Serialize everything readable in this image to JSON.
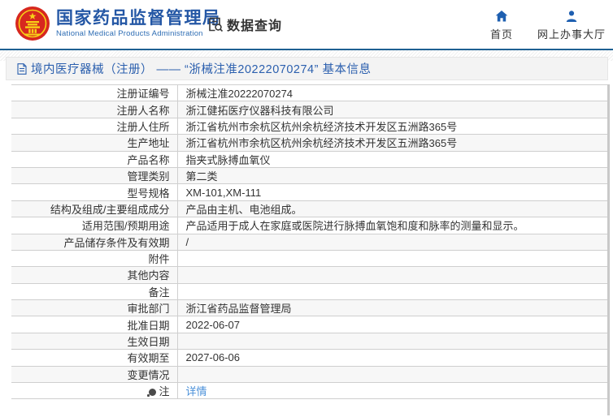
{
  "header": {
    "org_name_zh": "国家药品监督管理局",
    "org_name_en": "National Medical Products Administration",
    "data_query_label": "数据查询",
    "nav": [
      {
        "label": "首页",
        "icon": "home-icon"
      },
      {
        "label": "网上办事大厅",
        "icon": "user-icon"
      }
    ]
  },
  "breadcrumb": {
    "text": "境内医疗器械（注册） —— “浙械注准20222070274” 基本信息"
  },
  "table": {
    "rows": [
      {
        "label": "注册证编号",
        "value": "浙械注准20222070274"
      },
      {
        "label": "注册人名称",
        "value": "浙江健拓医疗仪器科技有限公司"
      },
      {
        "label": "注册人住所",
        "value": "浙江省杭州市余杭区杭州余杭经济技术开发区五洲路365号"
      },
      {
        "label": "生产地址",
        "value": "浙江省杭州市余杭区杭州余杭经济技术开发区五洲路365号"
      },
      {
        "label": "产品名称",
        "value": "指夹式脉搏血氧仪"
      },
      {
        "label": "管理类别",
        "value": "第二类"
      },
      {
        "label": "型号规格",
        "value": "XM-101,XM-111"
      },
      {
        "label": "结构及组成/主要组成成分",
        "value": "产品由主机、电池组成。"
      },
      {
        "label": "适用范围/预期用途",
        "value": "产品适用于成人在家庭或医院进行脉搏血氧饱和度和脉率的测量和显示。"
      },
      {
        "label": "产品储存条件及有效期",
        "value": "/"
      },
      {
        "label": "附件",
        "value": ""
      },
      {
        "label": "其他内容",
        "value": ""
      },
      {
        "label": "备注",
        "value": ""
      },
      {
        "label": "审批部门",
        "value": "浙江省药品监督管理局"
      },
      {
        "label": "批准日期",
        "value": "2022-06-07"
      },
      {
        "label": "生效日期",
        "value": ""
      },
      {
        "label": "有效期至",
        "value": "2027-06-06"
      },
      {
        "label": "变更情况",
        "value": ""
      },
      {
        "label": "注",
        "value": "详情",
        "label_icon": "bulb-icon",
        "value_is_link": true
      }
    ]
  },
  "colors": {
    "brand_blue": "#2457a5",
    "accent_blue": "#1e5fb0",
    "divider_blue": "#1e6092",
    "breadcrumb_blue": "#2b5fae",
    "link_blue": "#4a90d9",
    "emblem_red": "#d7281f",
    "emblem_gold": "#f7d117",
    "row_stripe": "#f7f7f7",
    "table_border": "#cfcfcf"
  }
}
